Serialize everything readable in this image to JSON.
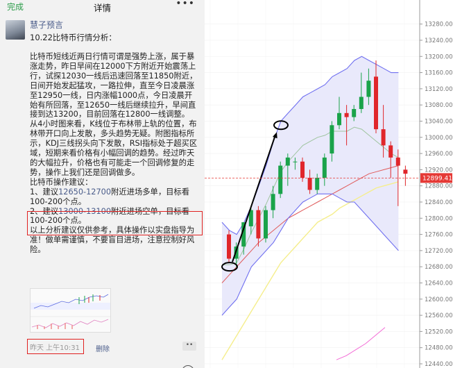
{
  "navbar": {
    "done_label": "完成",
    "title": "详情",
    "more_label": "•••"
  },
  "post": {
    "author": "慧子预言",
    "title": "10.22比特币行情分析：",
    "paragraphs": [
      "比特币短线近两日行情可谓是强势上涨，属于暴涨走势，昨日早间在12000下方附近开始震荡上行，试探12030一线后迅速回落至11850附近，日间开始发起猛攻，一路拉伸，直至今日凌晨涨至12950一线，日内涨幅1000点，今日凌晨开始有所回落，至12650一线后继续拉升，早间直接到达13200，目前回落在12800一线调整。",
      "从4小时图来看，K线位于布林带上轨的位置，布林带开口向上发散，多头趋势无疑。附图指标所示，KDJ三线拐头向下发散，RSI指标处于超买区域，短期来看价格有小幅回调的趋势。经过昨天的大幅拉升，价格也有可能走一个回调修复的走势，操作上我们还是回调做多。",
      "比特币操作建议："
    ],
    "advice1_prefix": "1、建议",
    "advice1_range": "12650-12700",
    "advice1_suffix": "附近进场多单，目标看100-200个点。",
    "advice2_prefix": "2、建议",
    "advice2_range": "13000-13100",
    "advice2_suffix": "附近进场空单，目标看100-200个点。",
    "closing": "以上分析建议仅供参考，具体操作以实盘指导为准！做单需谨慎，不要盲目进场，注意控制好风险。",
    "timestamp": "昨天 上午10:31",
    "delete_label": "删除",
    "comment_label": "••"
  },
  "chart_data": {
    "type": "candlestick",
    "price_axis": {
      "min": 12440,
      "max": 13300,
      "ticks": [
        13280,
        13240,
        13200,
        13160,
        13120,
        13080,
        13040,
        13000,
        12960,
        12920,
        12880,
        12840,
        12800,
        12760,
        12720,
        12680,
        12640,
        12600,
        12560,
        12520,
        12480,
        12440
      ],
      "tick_labels": [
        "13280.00",
        "13240.00",
        "13200.00",
        "13160.00",
        "13120.00",
        "13080.00",
        "13040.00",
        "13000.00",
        "12960.00",
        "12920.00",
        "12880.00",
        "12840.00",
        "12800.00",
        "12760.00",
        "12720.00",
        "12680.00",
        "12640.00",
        "12600.00",
        "12560.00",
        "12520.00",
        "12480.00",
        "12440.00"
      ]
    },
    "current_price": 12899.41,
    "current_price_label": "12899.41",
    "colors": {
      "up": "#1aa34a",
      "down": "#e0262b",
      "band": "#6f6ff0",
      "band_fill": "#e9e9fb",
      "ma_red": "#e05a5a",
      "ma_yellow": "#f5ee8c",
      "ma_mid": "#9fc49f",
      "price_tag": "#e53935",
      "pink_line": "#f36ad6"
    },
    "candles": [
      {
        "o": 12760,
        "h": 12770,
        "l": 12690,
        "c": 12700
      },
      {
        "o": 12700,
        "h": 12740,
        "l": 12680,
        "c": 12730
      },
      {
        "o": 12730,
        "h": 12790,
        "l": 12710,
        "c": 12790
      },
      {
        "o": 12780,
        "h": 12830,
        "l": 12760,
        "c": 12820
      },
      {
        "o": 12820,
        "h": 12830,
        "l": 12730,
        "c": 12750
      },
      {
        "o": 12750,
        "h": 12830,
        "l": 12740,
        "c": 12820
      },
      {
        "o": 12820,
        "h": 12880,
        "l": 12800,
        "c": 12860
      },
      {
        "o": 12860,
        "h": 12940,
        "l": 12850,
        "c": 12930
      },
      {
        "o": 12930,
        "h": 12960,
        "l": 12880,
        "c": 12950
      },
      {
        "o": 12940,
        "h": 12950,
        "l": 12920,
        "c": 12940
      },
      {
        "o": 12940,
        "h": 12950,
        "l": 12890,
        "c": 12900
      },
      {
        "o": 12900,
        "h": 12920,
        "l": 12860,
        "c": 12870
      },
      {
        "o": 12870,
        "h": 12910,
        "l": 12860,
        "c": 12900
      },
      {
        "o": 12900,
        "h": 12960,
        "l": 12880,
        "c": 12950
      },
      {
        "o": 12960,
        "h": 13040,
        "l": 12940,
        "c": 13030
      },
      {
        "o": 13030,
        "h": 13100,
        "l": 13020,
        "c": 13060
      },
      {
        "o": 13060,
        "h": 13080,
        "l": 12980,
        "c": 13050
      },
      {
        "o": 13050,
        "h": 13080,
        "l": 13040,
        "c": 13070
      },
      {
        "o": 13070,
        "h": 13160,
        "l": 13060,
        "c": 13100
      },
      {
        "o": 13100,
        "h": 13170,
        "l": 13080,
        "c": 13140
      },
      {
        "o": 13150,
        "h": 13190,
        "l": 13010,
        "c": 13020
      },
      {
        "o": 13020,
        "h": 13080,
        "l": 12950,
        "c": 12980
      },
      {
        "o": 12980,
        "h": 12990,
        "l": 12900,
        "c": 12950
      },
      {
        "o": 12950,
        "h": 12970,
        "l": 12830,
        "c": 12930
      },
      {
        "o": 12920,
        "h": 12930,
        "l": 12880,
        "c": 12910
      }
    ]
  }
}
